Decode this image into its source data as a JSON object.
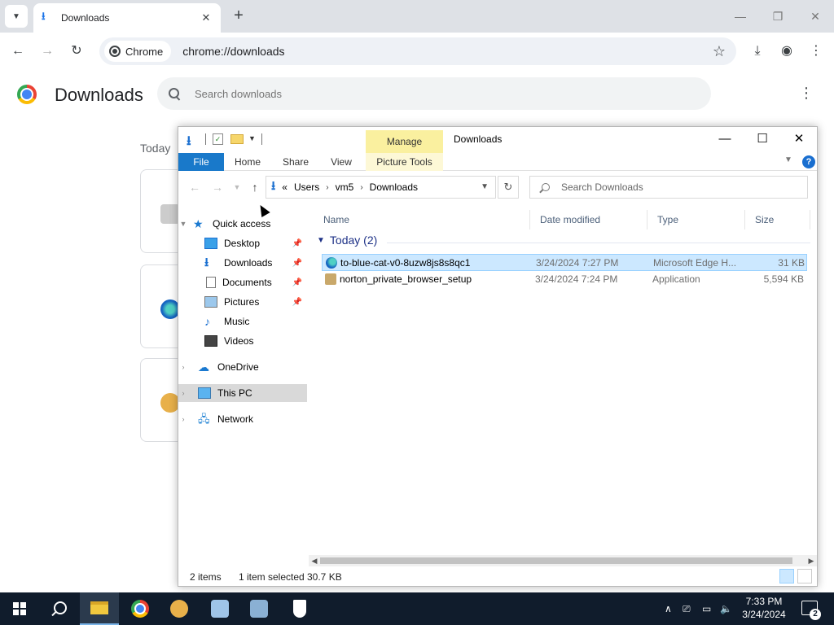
{
  "browser": {
    "tab": {
      "title": "Downloads"
    },
    "omnibox": {
      "chip_label": "Chrome",
      "url": "chrome://downloads"
    }
  },
  "downloads_page": {
    "title": "Downloads",
    "search_placeholder": "Search downloads",
    "date_heading": "Today"
  },
  "explorer": {
    "window_title": "Downloads",
    "contextual_tab": "Manage",
    "ribbon_tabs": [
      "File",
      "Home",
      "Share",
      "View",
      "Picture Tools"
    ],
    "address": {
      "prefix": "«",
      "crumbs": [
        "Users",
        "vm5",
        "Downloads"
      ]
    },
    "search_placeholder": "Search Downloads",
    "nav": {
      "quick_access": "Quick access",
      "items": [
        "Desktop",
        "Downloads",
        "Documents",
        "Pictures",
        "Music",
        "Videos"
      ],
      "onedrive": "OneDrive",
      "this_pc": "This PC",
      "network": "Network"
    },
    "columns": [
      "Name",
      "Date modified",
      "Type",
      "Size"
    ],
    "group": "Today (2)",
    "files": [
      {
        "name": "to-blue-cat-v0-8uzw8js8s8qc1",
        "date": "3/24/2024 7:27 PM",
        "type": "Microsoft Edge H...",
        "size": "31 KB",
        "selected": true,
        "icon": "edge-icon"
      },
      {
        "name": "norton_private_browser_setup",
        "date": "3/24/2024 7:24 PM",
        "type": "Application",
        "size": "5,594 KB",
        "selected": false,
        "icon": "app-icon"
      }
    ],
    "status": {
      "count": "2 items",
      "selection": "1 item selected",
      "size": "30.7 KB"
    }
  },
  "taskbar": {
    "clock_time": "7:33 PM",
    "clock_date": "3/24/2024",
    "notification_count": "2"
  },
  "colors": {
    "accent": "#1979ca",
    "selection": "#cce8ff",
    "taskbar": "#101c2c",
    "manage_tab": "#faf09f"
  }
}
